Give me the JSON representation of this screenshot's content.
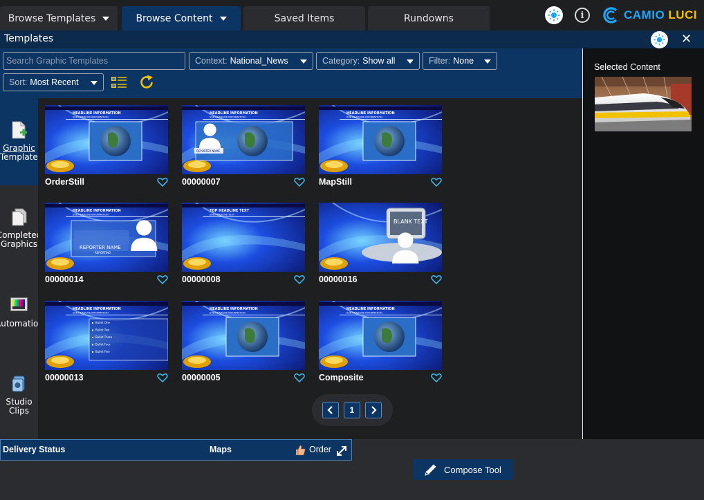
{
  "top_tabs": [
    {
      "label": "Browse Templates",
      "active": false
    },
    {
      "label": "Browse Content",
      "active": true
    },
    {
      "label": "Saved Items",
      "active": false
    },
    {
      "label": "Rundowns",
      "active": false
    }
  ],
  "brand": {
    "part1": "CAMIO",
    "part2": "LUCI",
    "color1": "#1aa8ff",
    "color2": "#f5c200"
  },
  "panel": {
    "title": "Templates"
  },
  "filters": {
    "search_placeholder": "Search Graphic Templates",
    "context": {
      "label": "Context:",
      "value": "National_News"
    },
    "category": {
      "label": "Category:",
      "value": "Show all"
    },
    "filter": {
      "label": "Filter:",
      "value": "None"
    },
    "sort": {
      "label": "Sort:",
      "value": "Most Recent"
    }
  },
  "sidebar": {
    "items": [
      {
        "label1": "Graphic",
        "label2": "Templates",
        "icon": "document-add-icon"
      },
      {
        "label1": "Completed",
        "label2": "Graphics",
        "icon": "documents-icon"
      },
      {
        "label1": "Automation",
        "label2": "",
        "icon": "test-pattern-icon"
      },
      {
        "label1": "Studio",
        "label2": "Clips",
        "icon": "film-clips-icon"
      }
    ]
  },
  "templates": [
    {
      "name": "OrderStill",
      "variant": "map"
    },
    {
      "name": "00000007",
      "variant": "reporter-map"
    },
    {
      "name": "MapStill",
      "variant": "map"
    },
    {
      "name": "00000014",
      "variant": "reporter"
    },
    {
      "name": "00000008",
      "variant": "blank"
    },
    {
      "name": "00000016",
      "variant": "blank-monitor"
    },
    {
      "name": "00000013",
      "variant": "bullets"
    },
    {
      "name": "00000005",
      "variant": "map"
    },
    {
      "name": "Composite",
      "variant": "map"
    }
  ],
  "thumb_text": {
    "headline": "HEADLINE INFORMATION",
    "sub_headline": "SUB HEADLINE INFORMATION",
    "top_headline": "TOP HEADLINE TEXT",
    "top_sub": "SUB HEADLINE TEXT",
    "reporter_name": "REPORTER NAME",
    "reporting": "REPORTING",
    "bullets": [
      "Bullet One",
      "Bullet Two",
      "Bullet Three",
      "Bullet Four",
      "Bullet Five"
    ],
    "monitor_text": "BLANK TEXT"
  },
  "pagination": {
    "current": "1"
  },
  "selected_content": {
    "title": "Selected Content"
  },
  "status_bar": {
    "delivery": "Delivery Status",
    "maps": "Maps",
    "order": "Order"
  },
  "compose": {
    "label": "Compose Tool"
  },
  "colors": {
    "accent": "#0c3563",
    "heart": "#3fb0e6",
    "refresh": "#f5c200"
  }
}
